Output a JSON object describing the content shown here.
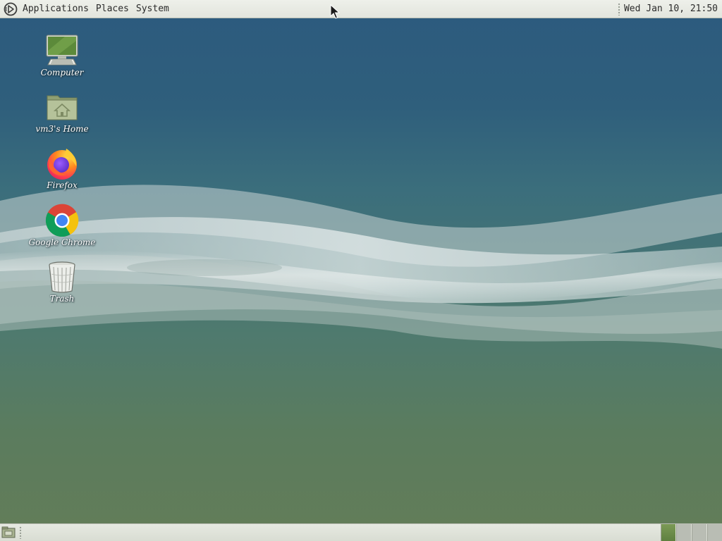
{
  "top_panel": {
    "menus": [
      {
        "label": "Applications"
      },
      {
        "label": "Places"
      },
      {
        "label": "System"
      }
    ],
    "clock": "Wed Jan 10, 21:50"
  },
  "desktop": {
    "icons": [
      {
        "label": "Computer",
        "icon": "computer-icon"
      },
      {
        "label": "vm3's Home",
        "icon": "home-folder-icon"
      },
      {
        "label": "Firefox",
        "icon": "firefox-icon"
      },
      {
        "label": "Google Chrome",
        "icon": "chrome-icon"
      },
      {
        "label": "Trash",
        "icon": "trash-icon"
      }
    ]
  },
  "bottom_panel": {
    "workspaces": [
      {
        "active": true
      },
      {
        "active": false
      },
      {
        "active": false
      },
      {
        "active": false
      }
    ]
  },
  "colors": {
    "panel": "#e2e5dd",
    "wallpaper_top": "#2c5a7e",
    "wallpaper_bottom": "#637d58",
    "workspace_active": "#6b8a48"
  }
}
